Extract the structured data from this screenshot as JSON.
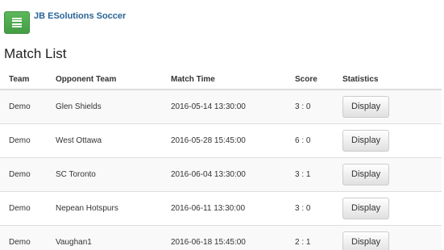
{
  "header": {
    "brand": "JB ESolutions Soccer",
    "menu_icon": "hamburger-icon",
    "menu_color": "#5cb85c"
  },
  "main": {
    "title": "Match List",
    "columns": [
      "Team",
      "Opponent Team",
      "Match Time",
      "Score",
      "Statistics"
    ],
    "rows": [
      {
        "team": "Demo",
        "opponent": "Glen Shields",
        "time": "2016-05-14 13:30:00",
        "score": "3 : 0",
        "action": "Display"
      },
      {
        "team": "Demo",
        "opponent": "West Ottawa",
        "time": "2016-05-28 15:45:00",
        "score": "6 : 0",
        "action": "Display"
      },
      {
        "team": "Demo",
        "opponent": "SC Toronto",
        "time": "2016-06-04 13:30:00",
        "score": "3 : 1",
        "action": "Display"
      },
      {
        "team": "Demo",
        "opponent": "Nepean Hotspurs",
        "time": "2016-06-11 13:30:00",
        "score": "3 : 0",
        "action": "Display"
      },
      {
        "team": "Demo",
        "opponent": "Vaughan1",
        "time": "2016-06-18 15:45:00",
        "score": "2 : 1",
        "action": "Display"
      }
    ]
  }
}
